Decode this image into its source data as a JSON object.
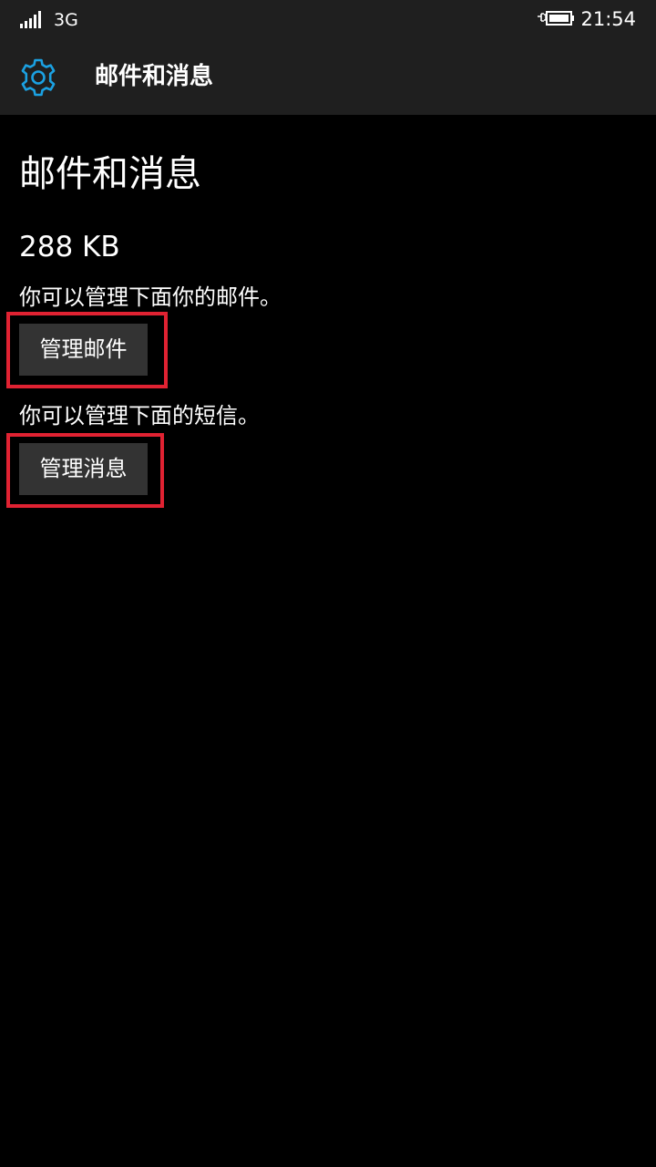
{
  "status_bar": {
    "network": "3G",
    "time": "21:54"
  },
  "header": {
    "title": "邮件和消息",
    "icon": "gear-icon",
    "icon_color": "#1ba1e2"
  },
  "main": {
    "page_title": "邮件和消息",
    "storage_size": "288 KB",
    "mail_description": "你可以管理下面你的邮件。",
    "mail_button_label": "管理邮件",
    "sms_description": "你可以管理下面的短信。",
    "sms_button_label": "管理消息"
  },
  "highlight_color": "#e02232"
}
